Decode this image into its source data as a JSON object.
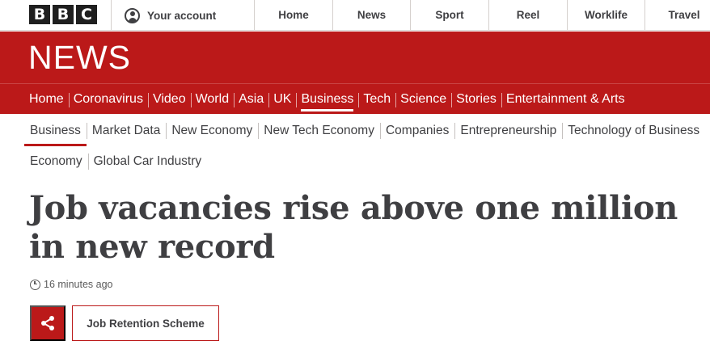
{
  "global_nav": {
    "logo_letters": [
      "B",
      "B",
      "C"
    ],
    "account_label": "Your account",
    "items": [
      "Home",
      "News",
      "Sport",
      "Reel",
      "Worklife",
      "Travel"
    ]
  },
  "masthead": {
    "title": "NEWS"
  },
  "news_nav": {
    "items": [
      "Home",
      "Coronavirus",
      "Video",
      "World",
      "Asia",
      "UK",
      "Business",
      "Tech",
      "Science",
      "Stories",
      "Entertainment & Arts"
    ],
    "active": "Business"
  },
  "business_nav": {
    "row1": [
      "Business",
      "Market Data",
      "New Economy",
      "New Tech Economy",
      "Companies",
      "Entrepreneurship",
      "Technology of Business"
    ],
    "row2": [
      "Economy",
      "Global Car Industry"
    ],
    "active": "Business"
  },
  "article": {
    "headline": "Job vacancies rise above one million in new record",
    "timestamp": "16 minutes ago",
    "share_icon": "share-icon",
    "tag": "Job Retention Scheme"
  },
  "colors": {
    "brand_red": "#bb1919",
    "text": "#3f3f42"
  }
}
